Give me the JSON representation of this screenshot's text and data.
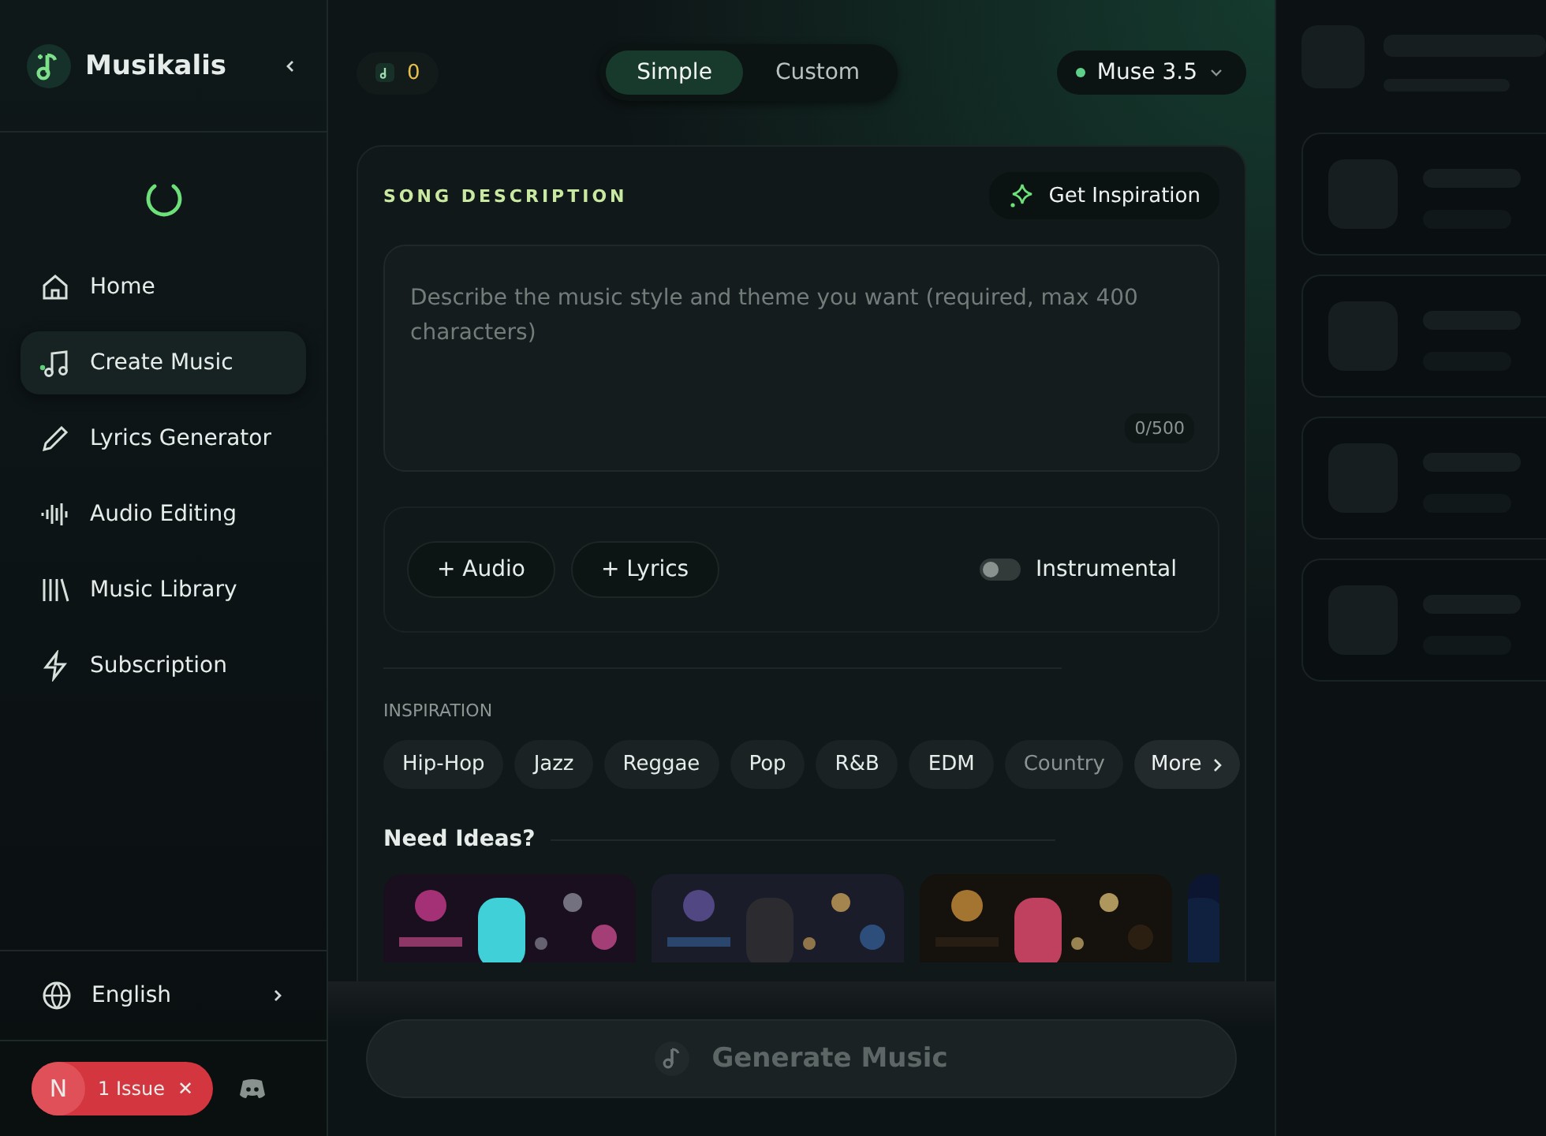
{
  "brand": {
    "name": "Musikalis"
  },
  "nav": [
    {
      "label": "Home",
      "kind": "home",
      "selected": false
    },
    {
      "label": "Create Music",
      "kind": "music",
      "selected": true
    },
    {
      "label": "Lyrics Generator",
      "kind": "pen",
      "selected": false
    },
    {
      "label": "Audio Editing",
      "kind": "wave",
      "selected": false
    },
    {
      "label": "Music Library",
      "kind": "library",
      "selected": false
    },
    {
      "label": "Subscription",
      "kind": "bolt",
      "selected": false
    }
  ],
  "language": "English",
  "issue_badge": {
    "avatar": "N",
    "label": "1 Issue",
    "close": "✕"
  },
  "credits": "0",
  "mode_tabs": [
    {
      "label": "Simple",
      "selected": true
    },
    {
      "label": "Custom",
      "selected": false
    }
  ],
  "model": {
    "label": "Muse 3.5"
  },
  "song_description": {
    "title": "SONG DESCRIPTION",
    "inspiration_button": "Get Inspiration",
    "placeholder": "Describe the music style and theme you want (required, max 400 characters)",
    "counter": "0/500"
  },
  "options": {
    "buttons": [
      "+ Audio",
      "+ Lyrics"
    ],
    "instrumental": {
      "label": "Instrumental",
      "on": false
    }
  },
  "inspiration": {
    "title": "INSPIRATION",
    "genres": [
      "Hip-Hop",
      "Jazz",
      "Reggae",
      "Pop",
      "R&B",
      "EDM",
      "Country"
    ],
    "more": "More"
  },
  "ideas": {
    "title": "Need Ideas?"
  },
  "generate_button": {
    "label": "Generate Music",
    "disabled": true
  }
}
